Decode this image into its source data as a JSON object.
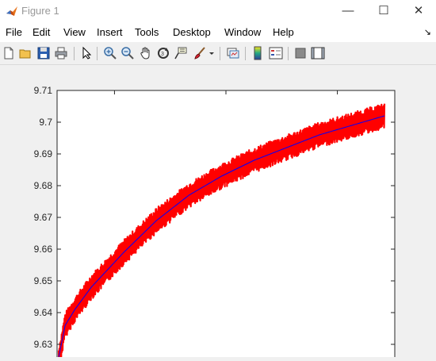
{
  "window": {
    "title": "Figure 1",
    "controls": {
      "minimize": "—",
      "maximize": "☐",
      "close": "✕"
    }
  },
  "menu": {
    "items": [
      "File",
      "Edit",
      "View",
      "Insert",
      "Tools",
      "Desktop",
      "Window",
      "Help"
    ],
    "overflow_icon": "dock-arrow-icon"
  },
  "toolbar": {
    "buttons": [
      "new-figure-icon",
      "open-file-icon",
      "save-icon",
      "print-icon",
      "edit-plot-arrow-icon",
      "zoom-in-icon",
      "zoom-out-icon",
      "pan-hand-icon",
      "rotate-3d-icon",
      "data-cursor-icon",
      "brush-icon",
      "brush-dropdown-icon",
      "link-plot-icon",
      "insert-colorbar-icon",
      "insert-legend-icon",
      "hide-plot-tools-icon",
      "show-plot-tools-icon"
    ]
  },
  "colors": {
    "noise_band": "#ff0000",
    "trend_line": "#0000ff",
    "axes_background": "#ffffff",
    "figure_background": "#f0f0f0"
  },
  "chart_data": {
    "type": "line",
    "title": "",
    "xlabel": "",
    "ylabel": "",
    "ylim": [
      9.62,
      9.71
    ],
    "yticks": [
      "9.71",
      "9.7",
      "9.69",
      "9.68",
      "9.67",
      "9.66",
      "9.65",
      "9.64",
      "9.63"
    ],
    "grid": false,
    "legend": "none",
    "series": [
      {
        "style": "red noisy band",
        "x": [
          0,
          0.02,
          0.05,
          0.1,
          0.2,
          0.3,
          0.4,
          0.5,
          0.6,
          0.7,
          0.8,
          0.9,
          1.0
        ],
        "y_center": [
          9.625,
          9.636,
          9.641,
          9.648,
          9.659,
          9.669,
          9.677,
          9.683,
          9.688,
          9.692,
          9.696,
          9.699,
          9.702
        ],
        "half_width": 0.004
      },
      {
        "style": "blue trend line",
        "x": [
          0,
          0.02,
          0.05,
          0.1,
          0.2,
          0.3,
          0.4,
          0.5,
          0.6,
          0.7,
          0.8,
          0.9,
          1.0
        ],
        "y": [
          9.626,
          9.636,
          9.641,
          9.648,
          9.659,
          9.669,
          9.677,
          9.683,
          9.688,
          9.692,
          9.696,
          9.699,
          9.702
        ]
      }
    ]
  }
}
